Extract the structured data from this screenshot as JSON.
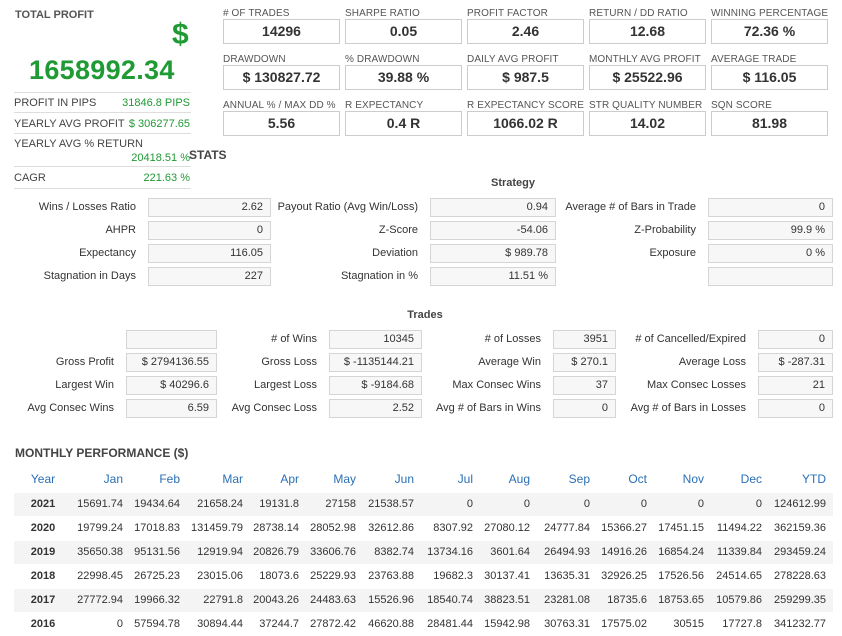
{
  "summary": {
    "total_profit_label": "TOTAL PROFIT",
    "currency_symbol": "$",
    "total_profit_value": "1658992.34",
    "rows": [
      {
        "label": "PROFIT IN PIPS",
        "value": "31846.8 PIPS"
      },
      {
        "label": "YEARLY AVG PROFIT",
        "value": "$ 306277.65"
      },
      {
        "label": "YEARLY AVG % RETURN",
        "value": "20418.51 %"
      },
      {
        "label": "CAGR",
        "value": "221.63 %"
      }
    ]
  },
  "metrics": [
    {
      "label": "# OF TRADES",
      "value": "14296"
    },
    {
      "label": "SHARPE RATIO",
      "value": "0.05"
    },
    {
      "label": "PROFIT FACTOR",
      "value": "2.46"
    },
    {
      "label": "RETURN / DD RATIO",
      "value": "12.68"
    },
    {
      "label": "WINNING PERCENTAGE",
      "value": "72.36 %"
    },
    {
      "label": "DRAWDOWN",
      "value": "$ 130827.72"
    },
    {
      "label": "% DRAWDOWN",
      "value": "39.88 %"
    },
    {
      "label": "DAILY AVG PROFIT",
      "value": "$ 987.5"
    },
    {
      "label": "MONTHLY AVG PROFIT",
      "value": "$ 25522.96"
    },
    {
      "label": "AVERAGE TRADE",
      "value": "$ 116.05"
    },
    {
      "label": "ANNUAL % / MAX DD %",
      "value": "5.56"
    },
    {
      "label": "R EXPECTANCY",
      "value": "0.4 R"
    },
    {
      "label": "R EXPECTANCY SCORE",
      "value": "1066.02 R"
    },
    {
      "label": "STR QUALITY NUMBER",
      "value": "14.02"
    },
    {
      "label": "SQN SCORE",
      "value": "81.98"
    }
  ],
  "stats_title": "STATS",
  "strategy": {
    "title": "Strategy",
    "rows": [
      [
        {
          "label": "Wins / Losses Ratio",
          "value": "2.62"
        },
        {
          "label": "Payout Ratio (Avg Win/Loss)",
          "value": "0.94"
        },
        {
          "label": "Average # of Bars in Trade",
          "value": "0"
        }
      ],
      [
        {
          "label": "AHPR",
          "value": "0"
        },
        {
          "label": "Z-Score",
          "value": "-54.06"
        },
        {
          "label": "Z-Probability",
          "value": "99.9 %"
        }
      ],
      [
        {
          "label": "Expectancy",
          "value": "116.05"
        },
        {
          "label": "Deviation",
          "value": "$ 989.78"
        },
        {
          "label": "Exposure",
          "value": "0 %"
        }
      ],
      [
        {
          "label": "Stagnation in Days",
          "value": "227"
        },
        {
          "label": "Stagnation in %",
          "value": "11.51 %"
        },
        {
          "label": "",
          "value": ""
        }
      ]
    ]
  },
  "trades": {
    "title": "Trades",
    "rows": [
      [
        {
          "label": "",
          "value": ""
        },
        {
          "label": "# of Wins",
          "value": "10345"
        },
        {
          "label": "# of Losses",
          "value": "3951"
        },
        {
          "label": "# of Cancelled/Expired",
          "value": "0"
        }
      ],
      [
        {
          "label": "Gross Profit",
          "value": "$ 2794136.55"
        },
        {
          "label": "Gross Loss",
          "value": "$ -1135144.21"
        },
        {
          "label": "Average Win",
          "value": "$ 270.1"
        },
        {
          "label": "Average Loss",
          "value": "$ -287.31"
        }
      ],
      [
        {
          "label": "Largest Win",
          "value": "$ 40296.6"
        },
        {
          "label": "Largest Loss",
          "value": "$ -9184.68"
        },
        {
          "label": "Max Consec Wins",
          "value": "37"
        },
        {
          "label": "Max Consec Losses",
          "value": "21"
        }
      ],
      [
        {
          "label": "Avg Consec Wins",
          "value": "6.59"
        },
        {
          "label": "Avg Consec Loss",
          "value": "2.52"
        },
        {
          "label": "Avg # of Bars in Wins",
          "value": "0"
        },
        {
          "label": "Avg # of Bars in Losses",
          "value": "0"
        }
      ]
    ]
  },
  "monthly": {
    "title": "MONTHLY PERFORMANCE ($)",
    "headers": [
      "Year",
      "Jan",
      "Feb",
      "Mar",
      "Apr",
      "May",
      "Jun",
      "Jul",
      "Aug",
      "Sep",
      "Oct",
      "Nov",
      "Dec",
      "YTD"
    ],
    "rows": [
      [
        "2021",
        "15691.74",
        "19434.64",
        "21658.24",
        "19131.8",
        "27158",
        "21538.57",
        "0",
        "0",
        "0",
        "0",
        "0",
        "0",
        "124612.99"
      ],
      [
        "2020",
        "19799.24",
        "17018.83",
        "131459.79",
        "28738.14",
        "28052.98",
        "32612.86",
        "8307.92",
        "27080.12",
        "24777.84",
        "15366.27",
        "17451.15",
        "11494.22",
        "362159.36"
      ],
      [
        "2019",
        "35650.38",
        "95131.56",
        "12919.94",
        "20826.79",
        "33606.76",
        "8382.74",
        "13734.16",
        "3601.64",
        "26494.93",
        "14916.26",
        "16854.24",
        "11339.84",
        "293459.24"
      ],
      [
        "2018",
        "22998.45",
        "26725.23",
        "23015.06",
        "18073.6",
        "25229.93",
        "23763.88",
        "19682.3",
        "30137.41",
        "13635.31",
        "32926.25",
        "17526.56",
        "24514.65",
        "278228.63"
      ],
      [
        "2017",
        "27772.94",
        "19966.32",
        "22791.8",
        "20043.26",
        "24483.63",
        "15526.96",
        "18540.74",
        "38823.51",
        "23281.08",
        "18735.6",
        "18753.65",
        "10579.86",
        "259299.35"
      ],
      [
        "2016",
        "0",
        "57594.78",
        "30894.44",
        "37244.7",
        "27872.42",
        "46620.88",
        "28481.44",
        "15942.98",
        "30763.31",
        "17575.02",
        "30515",
        "17727.8",
        "341232.77"
      ]
    ]
  },
  "colors": {
    "accent_green": "#1f9a35",
    "header_blue": "#2a6fb5",
    "row_alt": "#f4f4f4"
  }
}
